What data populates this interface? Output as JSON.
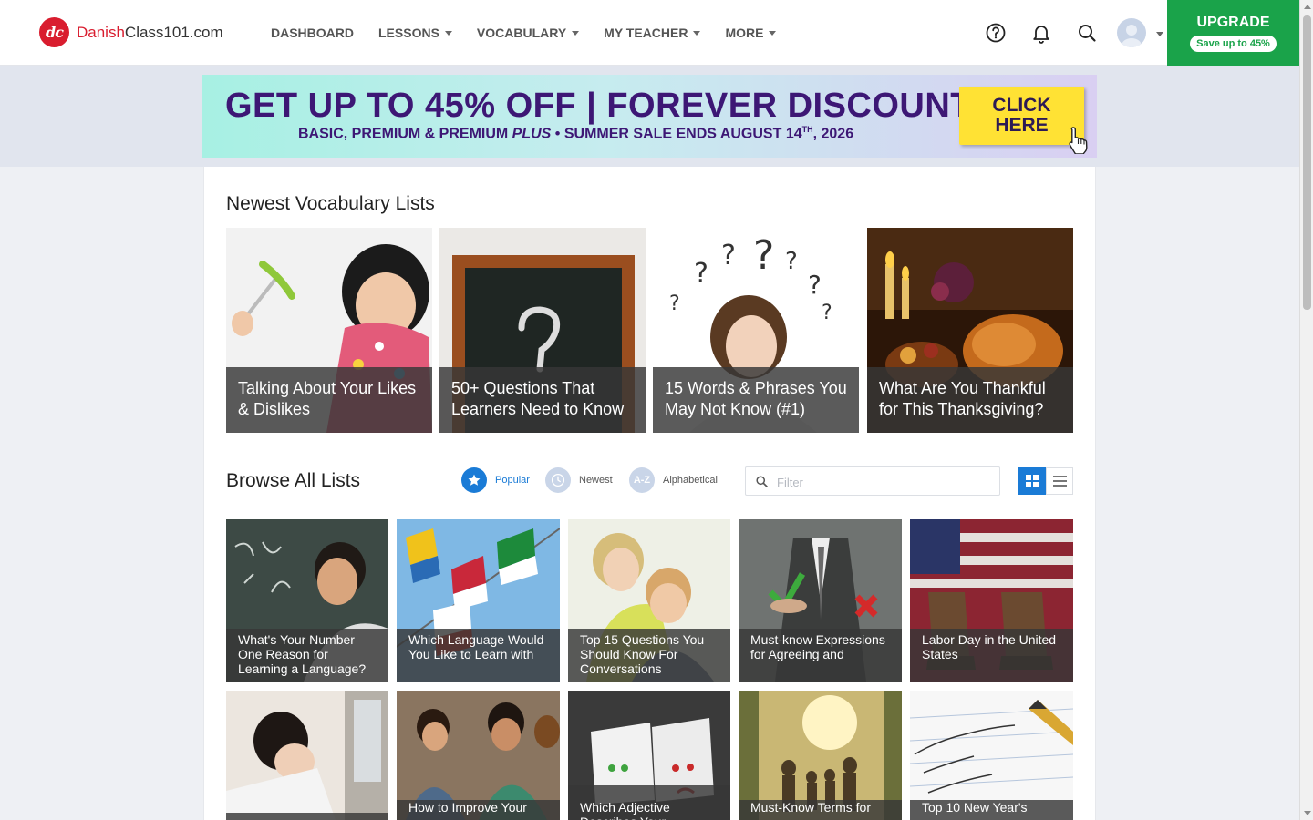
{
  "header": {
    "logo": {
      "brand": "Danish",
      "rest": "Class101.com",
      "mark": "dc"
    },
    "nav": [
      {
        "label": "DASHBOARD",
        "dropdown": false
      },
      {
        "label": "LESSONS",
        "dropdown": true
      },
      {
        "label": "VOCABULARY",
        "dropdown": true
      },
      {
        "label": "MY TEACHER",
        "dropdown": true
      },
      {
        "label": "MORE",
        "dropdown": true
      }
    ],
    "icons": [
      "help-icon",
      "bell-icon",
      "search-icon"
    ],
    "upgrade": {
      "title": "UPGRADE",
      "subtitle": "Save up to 45%"
    }
  },
  "banner": {
    "headline": "GET UP TO 45% OFF | FOREVER DISCOUNT",
    "sub_pre": "BASIC, PREMIUM & PREMIUM ",
    "sub_plus": "PLUS",
    "sub_post": " • SUMMER SALE ENDS AUGUST 14",
    "sub_sup": "TH",
    "sub_year": ", 2026",
    "cta_line1": "CLICK",
    "cta_line2": "HERE"
  },
  "newest": {
    "title": "Newest Vocabulary Lists",
    "items": [
      {
        "label": "Talking About Your Likes & Dislikes"
      },
      {
        "label": "50+ Questions That Learners Need to Know"
      },
      {
        "label": "15 Words & Phrases You May Not Know (#1)"
      },
      {
        "label": "What Are You Thankful for This Thanksgiving?"
      }
    ]
  },
  "browse": {
    "title": "Browse All Lists",
    "sort": [
      {
        "label": "Popular",
        "icon": "star-icon",
        "active": true
      },
      {
        "label": "Newest",
        "icon": "clock-icon",
        "active": false
      },
      {
        "label": "Alphabetical",
        "icon": "az-icon",
        "glyph": "A-Z",
        "active": false
      }
    ],
    "filter_placeholder": "Filter",
    "view": [
      "grid-view-icon",
      "list-view-icon"
    ],
    "items": [
      {
        "label": "What's Your Number One Reason for Learning a Language?"
      },
      {
        "label": "Which Language Would You Like to Learn with"
      },
      {
        "label": "Top 15 Questions You Should Know For Conversations"
      },
      {
        "label": "Must-know Expressions for Agreeing and"
      },
      {
        "label": "Labor Day in the United States"
      },
      {
        "label": ""
      },
      {
        "label": "How to Improve Your"
      },
      {
        "label": "Which Adjective Describes Your"
      },
      {
        "label": "Must-Know Terms for"
      },
      {
        "label": "Top 10 New Year's"
      }
    ]
  },
  "colors": {
    "brand_red": "#d91d2f",
    "upgrade_green": "#1aa34a",
    "banner_purple": "#3d1775",
    "cta_yellow": "#ffe234",
    "active_blue": "#1a7bd6"
  }
}
